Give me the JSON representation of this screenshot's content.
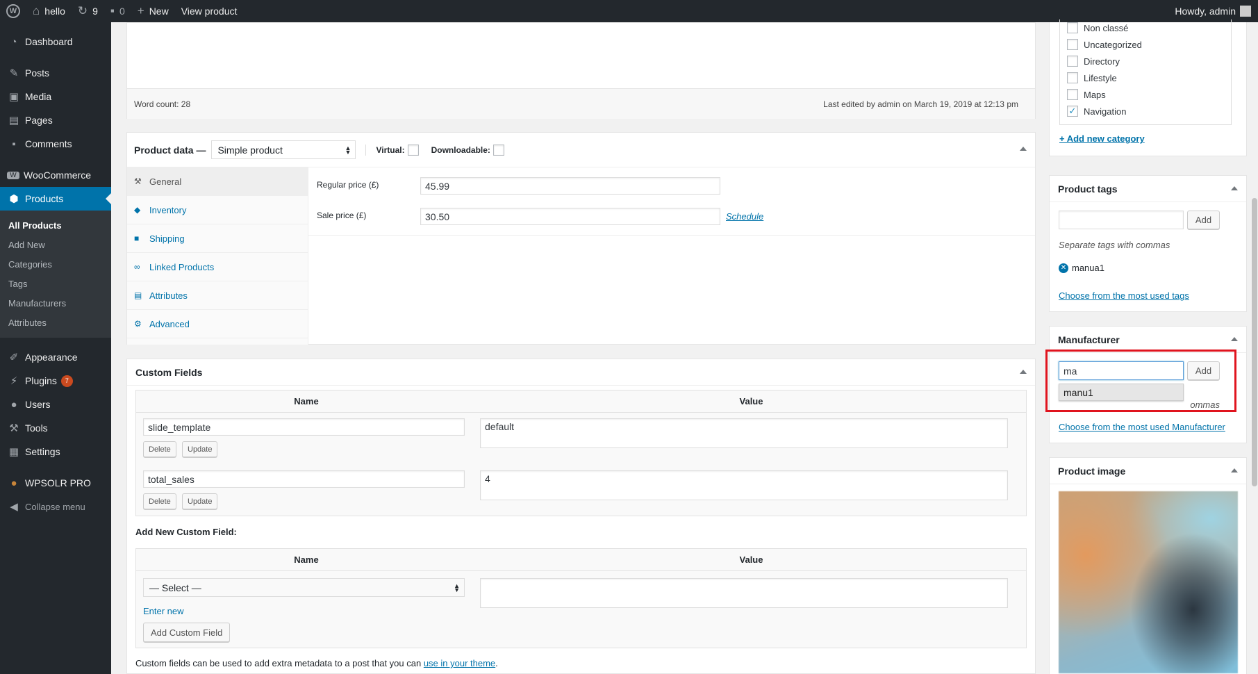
{
  "adminbar": {
    "site_name": "hello",
    "updates_count": "9",
    "comments_count": "0",
    "new_label": "New",
    "view_product": "View product",
    "howdy": "Howdy, admin"
  },
  "sidebar": {
    "items": [
      {
        "label": "Dashboard",
        "icon": "dashboard-icon"
      },
      {
        "label": "Posts",
        "icon": "pin-icon"
      },
      {
        "label": "Media",
        "icon": "media-icon"
      },
      {
        "label": "Pages",
        "icon": "pages-icon"
      },
      {
        "label": "Comments",
        "icon": "comment-icon"
      },
      {
        "label": "WooCommerce",
        "icon": "woo-icon"
      },
      {
        "label": "Products",
        "icon": "box-icon"
      },
      {
        "label": "Appearance",
        "icon": "brush-icon"
      },
      {
        "label": "Plugins",
        "icon": "plugin-icon",
        "badge": "7"
      },
      {
        "label": "Users",
        "icon": "user-icon"
      },
      {
        "label": "Tools",
        "icon": "wrench-icon"
      },
      {
        "label": "Settings",
        "icon": "settings-icon"
      },
      {
        "label": "WPSOLR PRO",
        "icon": "solr-icon"
      },
      {
        "label": "Collapse menu",
        "icon": "collapse-icon"
      }
    ],
    "submenu": [
      "All Products",
      "Add New",
      "Categories",
      "Tags",
      "Manufacturers",
      "Attributes"
    ]
  },
  "editor": {
    "word_count": "Word count: 28",
    "last_edited": "Last edited by admin on March 19, 2019 at 12:13 pm"
  },
  "product_data": {
    "title": "Product data —",
    "type_value": "Simple product",
    "virtual_label": "Virtual:",
    "downloadable_label": "Downloadable:",
    "tabs": [
      "General",
      "Inventory",
      "Shipping",
      "Linked Products",
      "Attributes",
      "Advanced"
    ],
    "regular_price_label": "Regular price (£)",
    "regular_price_value": "45.99",
    "sale_price_label": "Sale price (£)",
    "sale_price_value": "30.50",
    "schedule_link": "Schedule"
  },
  "custom_fields": {
    "title": "Custom Fields",
    "name_header": "Name",
    "value_header": "Value",
    "rows": [
      {
        "name": "slide_template",
        "value": "default"
      },
      {
        "name": "total_sales",
        "value": "4"
      }
    ],
    "delete_label": "Delete",
    "update_label": "Update",
    "add_new_label": "Add New Custom Field:",
    "select_value": "— Select —",
    "enter_new": "Enter new",
    "add_button": "Add Custom Field",
    "footer_text": "Custom fields can be used to add extra metadata to a post that you can",
    "footer_link": "use in your theme",
    "footer_end": "."
  },
  "categories": {
    "items": [
      {
        "label": "Non classé",
        "checked": false
      },
      {
        "label": "Uncategorized",
        "checked": false
      },
      {
        "label": "Directory",
        "checked": false
      },
      {
        "label": "Lifestyle",
        "checked": false
      },
      {
        "label": "Maps",
        "checked": false
      },
      {
        "label": "Navigation",
        "checked": true
      }
    ],
    "add_new": "+ Add new category"
  },
  "product_tags": {
    "title": "Product tags",
    "add_label": "Add",
    "hint": "Separate tags with commas",
    "tag": "manua1",
    "choose_link": "Choose from the most used tags"
  },
  "manufacturer": {
    "title": "Manufacturer",
    "input_value": "ma",
    "add_label": "Add",
    "suggestion": "manu1",
    "hint_tail": "ommas",
    "choose_link": "Choose from the most used Manufacturer"
  },
  "product_image": {
    "title": "Product image"
  },
  "colors": {
    "accent": "#0073aa",
    "admin_dark": "#23282d",
    "highlight_red": "#e0141e"
  }
}
